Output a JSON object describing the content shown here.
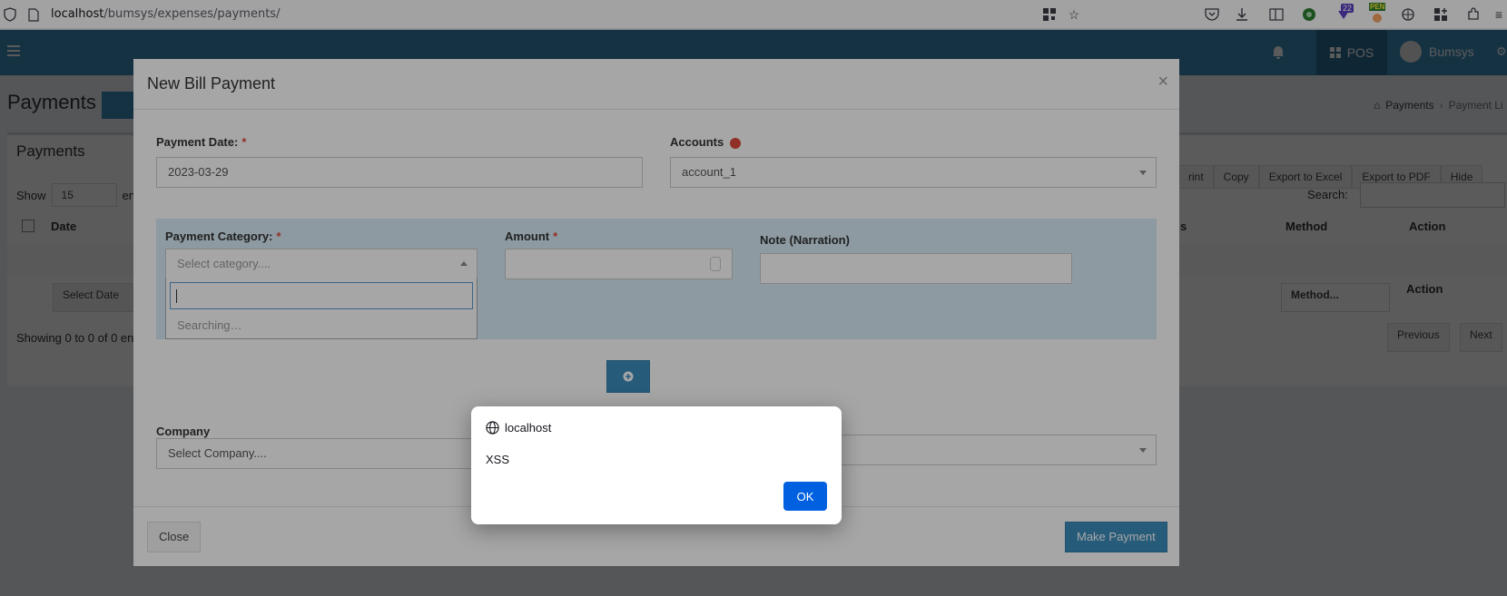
{
  "browser": {
    "url_host": "localhost",
    "url_path": "/bumsys/expenses/payments/",
    "downloads_badge": "22",
    "pen_badge": "PEN"
  },
  "app": {
    "pos_label": "POS",
    "user_name": "Bumsys"
  },
  "background": {
    "page_title": "Payments",
    "box_title": "Payments",
    "breadcrumb_payments": "Payments",
    "breadcrumb_list": "Payment Li",
    "show_label": "Show",
    "show_value": "15",
    "entries_fragment": "en",
    "export_buttons": [
      "rint",
      "Copy",
      "Export to Excel",
      "Export to PDF",
      "Hide"
    ],
    "search_label": "Search:",
    "col_date": "Date",
    "col_s": "s",
    "col_method": "Method",
    "col_action": "Action",
    "select_date": "Select Date",
    "method_select": "Method...",
    "action_label": "Action",
    "showing_text": "Showing 0 to 0 of 0 ent",
    "prev": "Previous",
    "next": "Next"
  },
  "modal": {
    "title": "New Bill Payment",
    "close_x": "×",
    "payment_date_label": "Payment Date:",
    "payment_date_value": "2023-03-29",
    "accounts_label": "Accounts",
    "accounts_value": "account_1",
    "category_label": "Payment Category:",
    "category_placeholder": "Select category....",
    "category_search_status": "Searching…",
    "amount_label": "Amount",
    "note_label": "Note (Narration)",
    "company_label": "Company",
    "company_placeholder": "Select Company....",
    "close_button": "Close",
    "make_payment_button": "Make Payment",
    "required_mark": "*"
  },
  "alert": {
    "host": "localhost",
    "message": "XSS",
    "ok_label": "OK"
  },
  "colors": {
    "header": "#3c8dbc",
    "primary_button": "#3c8dbc",
    "alert_ok": "#0061e0",
    "category_panel": "#d9edf7"
  }
}
